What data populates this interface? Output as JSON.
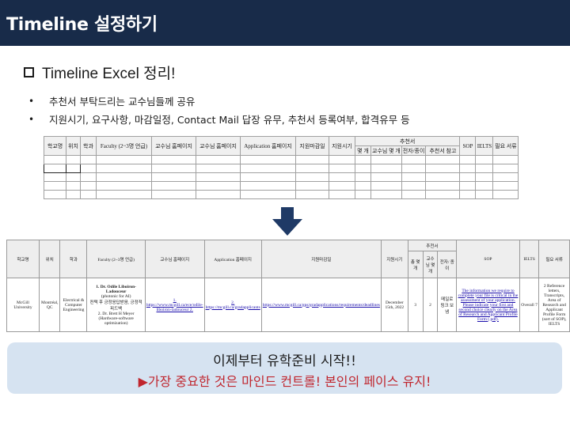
{
  "header": {
    "title": "Timeline 설정하기"
  },
  "section": {
    "heading": "Timeline Excel 정리!"
  },
  "bullets": [
    {
      "mark": "•",
      "text": "추천서 부탁드리는 교수님들께 공유"
    },
    {
      "mark": "•",
      "text": "지원시기, 요구사항, 마감일정, Contact Mail 답장 유무, 추천서 등록여부, 합격유무 등"
    }
  ],
  "template_table": {
    "group_header": "추천서",
    "columns": [
      "학교명",
      "위치",
      "학과",
      "Faculty (2~3명 언급)",
      "교수님 홈페이지",
      "교수님 홈페이지",
      "Application 홈페이지",
      "지원마감일",
      "지원시기",
      "SOP",
      "IELTS",
      "필요 서류"
    ],
    "sub_columns": [
      "몇 개",
      "교수님 몇 개",
      "전자/종이",
      "추천서 참고"
    ]
  },
  "detail_table": {
    "group_header": "추천서",
    "columns": [
      "학교명",
      "위치",
      "학과",
      "Faculty (2~3명 언급)",
      "교수님 홈페이지",
      "Application 홈페이지",
      "지원마감일",
      "지원시기",
      "SOP",
      "IELTS",
      "필요 서류"
    ],
    "sub_columns": [
      "총 몇 개",
      "교수 님 몇 개",
      "전자/ 종이"
    ],
    "row": {
      "school": "McGill University",
      "location": "Montréal, QC",
      "department": "Electrical & Computer Engineering",
      "faculty_1": "1. Dr. Odile Liboiron-Ladouceur",
      "faculty_1_note": "(photonic for AI)",
      "faculty_1_note2": "컨택 후 긍정응답받음, 긍정적 피드백",
      "faculty_2": "2. Dr. Brett H Meyer (Hardware-software optimization)",
      "prof_homepage": "1. https://www.mcgill.ca/ece/odile-liboiron-ladouceur 2.",
      "app_homepage": "2. https://mcgill.ca/gradapplicants",
      "deadline": "https://www.mcgill.ca/gps/gradapplications/requirements/deadlines",
      "period": "December 15th, 2022",
      "rec_total": "3",
      "rec_prof": "2",
      "rec_type": "메일로 링크 보냄",
      "sop": "The information we require to complete your file is critical in the assessment of your application. Please indicate your first and second choice clearly on the Area of Research and Applicant Profile Form (.pdf).",
      "ielts": "Overall 7",
      "documents": "2 Reference letters, Transcripts, Area of Research and Applicant Profile Form (sort of SOP), IELTS"
    }
  },
  "banner": {
    "line1": "이제부터 유학준비 시작!!",
    "line2": "▶가장 중요한 것은 마인드 컨트롤! 본인의 페이스 유지!"
  },
  "colors": {
    "title_bar": "#182b49",
    "banner_bg": "#d6e3f1",
    "accent_red": "#c0262e",
    "arrow": "#1f3a66"
  }
}
